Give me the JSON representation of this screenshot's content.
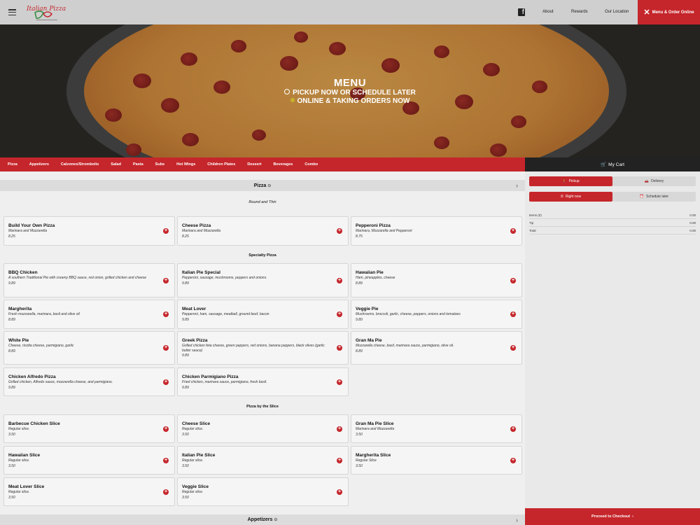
{
  "header": {
    "logo_text": "Italian Pizza Pie",
    "facebook_icon": "facebook-icon",
    "nav": [
      "About",
      "Rewards",
      "Our Location"
    ],
    "order_button": "Menu & Order Online"
  },
  "hero": {
    "title": "MENU",
    "line1": "PICKUP NOW OR SCHEDULE LATER",
    "line2": "ONLINE & TAKING ORDERS NOW"
  },
  "categories": [
    "Pizza",
    "Appetizers",
    "Calzones/Strombolis",
    "Salad",
    "Pasta",
    "Subs",
    "Hot Wings",
    "Children Plates",
    "Dessert",
    "Beverages",
    "Combo"
  ],
  "cart": {
    "title": "My Cart",
    "pickup": "Pickup",
    "delivery": "Delivery",
    "right_now": "Right now",
    "schedule_later": "Schedule later",
    "rows": [
      {
        "label": "Items (0)",
        "value": "0.00"
      },
      {
        "label": "Tip",
        "value": "0.00"
      },
      {
        "label": "Total",
        "value": "0.00"
      }
    ],
    "checkout": "Proceed to Checkout"
  },
  "menu": {
    "pizza_section": "Pizza",
    "pizza_note": "Round and Thin",
    "pizza_items": [
      {
        "name": "Build Your Own Pizza",
        "desc": "Marinara and Mozzarella",
        "price": "8.25"
      },
      {
        "name": "Cheese Pizza",
        "desc": "Marinara and Mozzarella",
        "price": "8.25"
      },
      {
        "name": "Pepperoni Pizza",
        "desc": "Marinara, Mozzarella and Pepperoni",
        "price": "8.75"
      }
    ],
    "specialty_title": "Specialty Pizza",
    "specialty_items": [
      {
        "name": "BBQ Chicken",
        "desc": "A southern Traditional Pie with creamy BBQ sauce, red onion, grilled chicken and cheese",
        "price": "9.89"
      },
      {
        "name": "Italian Pie Special",
        "desc": "Pepperoni, sausage, mushrooms, peppers and onions.",
        "price": "9.89"
      },
      {
        "name": "Hawaiian Pie",
        "desc": "Ham, pineapples, cheese",
        "price": "8.89"
      },
      {
        "name": "Margherita",
        "desc": "Fresh mozzarella, marinara, basil and olive oil",
        "price": "8.89"
      },
      {
        "name": "Meat Lover",
        "desc": "Pepperoni, ham, sausage, meatball, ground beef, bacon",
        "price": "9.89"
      },
      {
        "name": "Veggie Pie",
        "desc": "Mushrooms, broccoli, garlic, cheese, peppers, onions and tomatoes",
        "price": "9.89"
      },
      {
        "name": "White Pie",
        "desc": "Cheese, ricotta cheese, parmigiano, garlic",
        "price": "8.89"
      },
      {
        "name": "Greek Pizza",
        "desc": "Grilled chicken feta cheese, green peppers, red onions, banana peppers, black olives (garlic butter sauce)",
        "price": "9.89"
      },
      {
        "name": "Gran Ma Pie",
        "desc": "Mozzarella cheese, basil, marinara sauce, parmigiano, olive oil.",
        "price": "8.89"
      },
      {
        "name": "Chicken Alfredo Pizza",
        "desc": "Grilled chicken, Alfredo sauce, mozzarella cheese, and parmigiano.",
        "price": "9.89"
      },
      {
        "name": "Chicken Parmigiano Pizza",
        "desc": "Fried chicken, marinara sauce, parmigiano, fresh basil.",
        "price": "9.89"
      }
    ],
    "slice_title": "Pizza by the Slice",
    "slice_items": [
      {
        "name": "Barbecue Chicken Slice",
        "desc": "Regular slice.",
        "price": "3.50"
      },
      {
        "name": "Cheese Slice",
        "desc": "Regular slice.",
        "price": "3.50"
      },
      {
        "name": "Gran Ma Pie Slice",
        "desc": "Marinara and Mozzarella",
        "price": "3.50"
      },
      {
        "name": "Hawaiian Slice",
        "desc": "Regular slice.",
        "price": "3.50"
      },
      {
        "name": "Italian Pie Slice",
        "desc": "Regular slice.",
        "price": "3.50"
      },
      {
        "name": "Margherita Slice",
        "desc": "Regular Slice",
        "price": "3.50"
      },
      {
        "name": "Meat Lover Slice",
        "desc": "Regular slice.",
        "price": "3.50"
      },
      {
        "name": "Veggie Slice",
        "desc": "Regular slice.",
        "price": "3.50"
      }
    ],
    "appetizers_section": "Appetizers"
  }
}
